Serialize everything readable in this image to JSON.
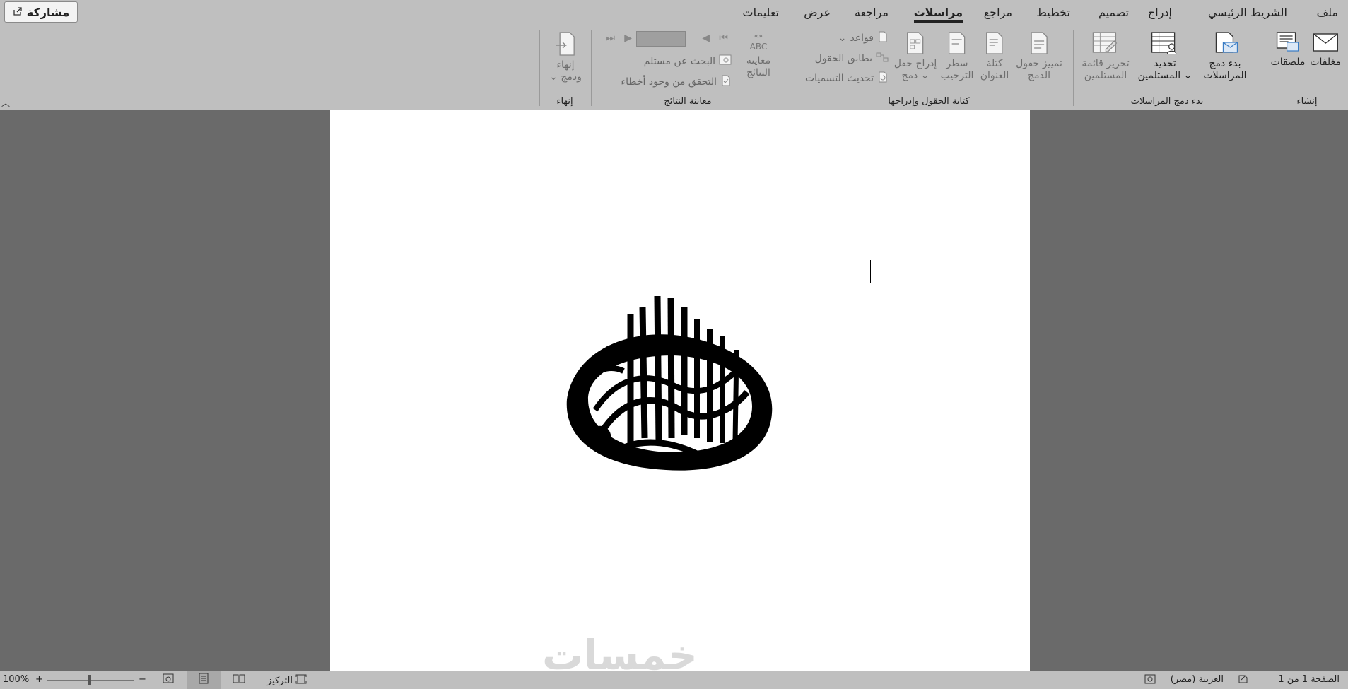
{
  "tabs": [
    "ملف",
    "الشريط الرئيسي",
    "إدراج",
    "تصميم",
    "تخطيط",
    "مراجع",
    "مراسلات",
    "مراجعة",
    "عرض",
    "تعليمات"
  ],
  "active_tab": "مراسلات",
  "share_label": "مشاركة",
  "groups": {
    "create": {
      "label": "إنشاء",
      "envelopes": "مغلفات",
      "labels": "ملصقات"
    },
    "start_merge": {
      "label": "بدء دمج المراسلات",
      "start_mail_merge": [
        "بدء دمج",
        "المراسلات"
      ],
      "select_recipients": [
        "تحديد",
        "المستلمين"
      ],
      "edit_recipient_list": [
        "تحرير قائمة",
        "المستلمين"
      ]
    },
    "write_insert": {
      "label": "كتابة الحقول وإدراجها",
      "highlight_merge_fields": [
        "تمييز حقول",
        "الدمج"
      ],
      "address_block": [
        "كتلة",
        "العنوان"
      ],
      "greeting_line": [
        "سطر",
        "الترحيب"
      ],
      "insert_merge_field": [
        "إدراج حقل",
        "دمج"
      ],
      "rules": "قواعد",
      "match_fields": "تطابق الحقول",
      "update_labels": "تحديث التسميات"
    },
    "preview": {
      "label": "معاينة النتائج",
      "preview_results": [
        "معاينة",
        "النتائج"
      ],
      "find_recipient": "البحث عن مستلم",
      "check_errors": "التحقق من وجود أخطاء"
    },
    "finish": {
      "label": "إنهاء",
      "finish_merge": [
        "إنهاء",
        "ودمج"
      ]
    }
  },
  "document": {
    "watermark": "خمسات"
  },
  "status": {
    "page": "الصفحة 1 من 1",
    "language": "العربية (مصر)",
    "focus": "التركيز",
    "zoom": "100%"
  },
  "colors": {
    "ribbon": "#bfbfbf",
    "canvas": "#6a6a6a",
    "page": "#ffffff"
  }
}
